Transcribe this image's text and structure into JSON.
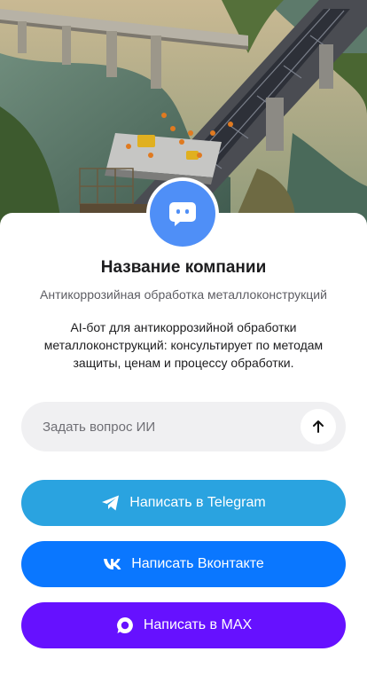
{
  "company": {
    "name": "Название компании",
    "subtitle": "Антикоррозийная обработка металлоконструкций",
    "description": "AI-бот для антикоррозийной обработки металлоконструкций: консультирует по методам защиты, ценам и процессу обработки."
  },
  "ask": {
    "placeholder": "Задать вопрос ИИ"
  },
  "buttons": {
    "telegram": {
      "label": "Написать в Telegram",
      "color": "#2aa3e0",
      "icon": "telegram-icon"
    },
    "vk": {
      "label": "Написать Вконтакте",
      "color": "#0a77ff",
      "icon": "vk-icon"
    },
    "max": {
      "label": "Написать в MAX",
      "color": "#6611ff",
      "icon": "max-icon"
    }
  },
  "avatar": {
    "color": "#4f8ff7",
    "icon": "chat-bot-icon"
  }
}
